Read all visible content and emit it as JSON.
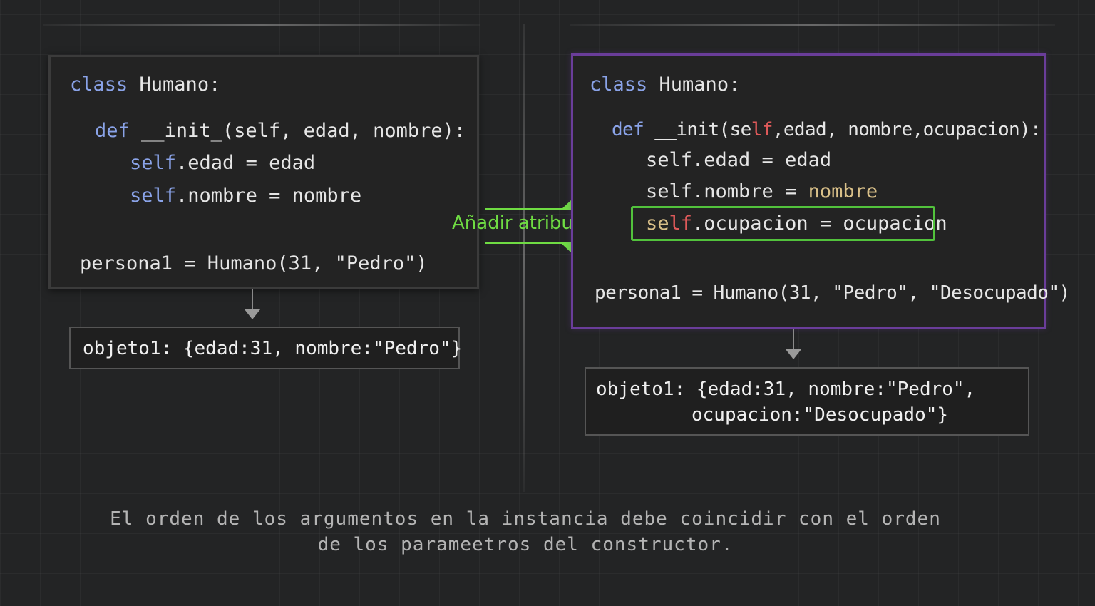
{
  "left_panel": {
    "class_keyword": "class",
    "class_name": " Humano:",
    "def_keyword": "def",
    "def_signature": " __init_(self, edad, nombre):",
    "assign1_self": "self",
    "assign1_rest": ".edad = edad",
    "assign2_self": "self",
    "assign2_rest": ".nombre = nombre",
    "instance": "persona1 = Humano(31, \"Pedro\")"
  },
  "left_output": {
    "text": "objeto1: {edad:31, nombre:\"Pedro\"}"
  },
  "right_panel": {
    "class_keyword": "class",
    "class_name": " Humano:",
    "def_keyword": "def",
    "def_sig_a": " __init(se",
    "def_sig_lf": "lf",
    "def_sig_b": ",edad, nombre,ocupacion):",
    "assign1": "self.edad = edad",
    "assign2_a": "self.nombre = ",
    "assign2_b": "nombre",
    "assign3_se": "se",
    "assign3_lf": "lf",
    "assign3_rest": ".ocupacion = ocupacion",
    "instance": "persona1 = Humano(31, \"Pedro\", \"Desocupado\")"
  },
  "right_output": {
    "line1": "objeto1: {edad:31, nombre:\"Pedro\",",
    "line2": "ocupacion:\"Desocupado\"}"
  },
  "annotation": {
    "label": "Añadir atributo."
  },
  "caption": {
    "line1": "El orden de los argumentos en la instancia debe coincidir con el orden",
    "line2": "de los parameetros del constructor."
  },
  "colors": {
    "keyword": "#8aa3e8",
    "highlight": "#52c23c",
    "annotation": "#6fdc43",
    "right_border": "#6a3d9a"
  }
}
